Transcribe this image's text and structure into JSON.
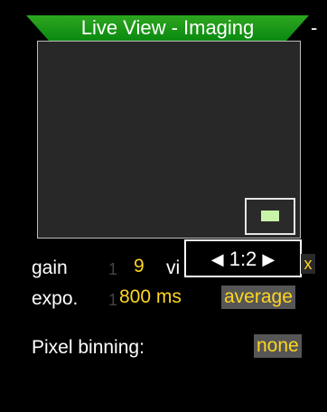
{
  "header": {
    "title": "Live View - Imaging",
    "extra": "-"
  },
  "preview": {
    "navigator_icon": "viewport-rectangle-icon"
  },
  "settings": {
    "gain_label": "gain",
    "gain_value": "9",
    "gain_faint": "1",
    "view_label_partial": "vi",
    "view_suffix": "x",
    "expo_label": "expo.",
    "expo_faint": "1",
    "expo_value": "800 ms",
    "expo_mode": "average",
    "pixel_binning_label": "Pixel binning:",
    "pixel_binning_value": "none"
  },
  "zoom": {
    "left_arrow": "◀",
    "value": "1:2",
    "right_arrow": "▶"
  },
  "colors": {
    "title_green": "#1a9c1a",
    "value_yellow": "#ffd61f",
    "value_bg": "#565656",
    "preview_bg": "#282828"
  }
}
